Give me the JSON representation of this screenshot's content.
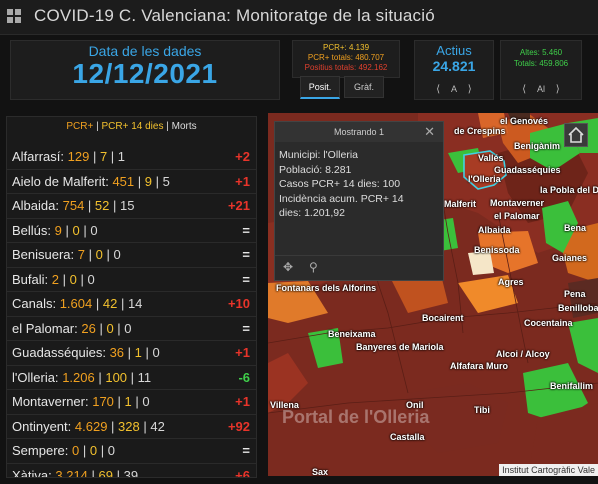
{
  "header": {
    "title": "COVID-19 C. Valenciana: Monitoratge de la situació",
    "icon": "grid-app-icon"
  },
  "date_panel": {
    "label": "Data de les dades",
    "value": "12/12/2021"
  },
  "pcr_panel": {
    "line1": "PCR+: 4.139",
    "line2": "PCR+ totals: 480.707",
    "line3": "Positius totals: 492.162"
  },
  "tabs": [
    {
      "label": "Posit."
    },
    {
      "label": "Gràf."
    }
  ],
  "actius_panel": {
    "label": "Actius",
    "value": "24.821",
    "pager_label": "A"
  },
  "altes_panel": {
    "line1": "Altes: 5.460",
    "line2": "Totals: 459.806",
    "pager_label": "Al"
  },
  "list": {
    "legend": {
      "pcr": "PCR+",
      "pcr14": "PCR+ 14 dies",
      "morts": "Morts"
    },
    "rows": [
      {
        "name": "Alfarrasí:",
        "pcr": "129",
        "pcr14": "7",
        "morts": "1",
        "delta": "+2",
        "delta_type": "pos"
      },
      {
        "name": "Aielo de Malferit:",
        "pcr": "451",
        "pcr14": "9",
        "morts": "5",
        "delta": "+1",
        "delta_type": "pos"
      },
      {
        "name": "Albaida:",
        "pcr": "754",
        "pcr14": "52",
        "morts": "15",
        "delta": "+21",
        "delta_type": "pos"
      },
      {
        "name": "Bellús:",
        "pcr": "9",
        "pcr14": "0",
        "morts": "0",
        "delta": "=",
        "delta_type": "eq"
      },
      {
        "name": "Benisuera:",
        "pcr": "7",
        "pcr14": "0",
        "morts": "0",
        "delta": "=",
        "delta_type": "eq"
      },
      {
        "name": "Bufali:",
        "pcr": "2",
        "pcr14": "0",
        "morts": "0",
        "delta": "=",
        "delta_type": "eq"
      },
      {
        "name": "Canals:",
        "pcr": "1.604",
        "pcr14": "42",
        "morts": "14",
        "delta": "+10",
        "delta_type": "pos"
      },
      {
        "name": "el Palomar:",
        "pcr": "26",
        "pcr14": "0",
        "morts": "0",
        "delta": "=",
        "delta_type": "eq"
      },
      {
        "name": "Guadasséquies:",
        "pcr": "36",
        "pcr14": "1",
        "morts": "0",
        "delta": "+1",
        "delta_type": "pos"
      },
      {
        "name": "l'Olleria:",
        "pcr": "1.206",
        "pcr14": "100",
        "morts": "11",
        "delta": "-6",
        "delta_type": "neg"
      },
      {
        "name": "Montaverner:",
        "pcr": "170",
        "pcr14": "1",
        "morts": "0",
        "delta": "+1",
        "delta_type": "pos"
      },
      {
        "name": "Ontinyent:",
        "pcr": "4.629",
        "pcr14": "328",
        "morts": "42",
        "delta": "+92",
        "delta_type": "pos"
      },
      {
        "name": "Sempere:",
        "pcr": "0",
        "pcr14": "0",
        "morts": "0",
        "delta": "=",
        "delta_type": "eq"
      },
      {
        "name": "Xàtiva:",
        "pcr": "3.214",
        "pcr14": "69",
        "morts": "39",
        "delta": "+6",
        "delta_type": "pos"
      }
    ]
  },
  "map": {
    "attribution": "Institut Cartogràfic Vale",
    "watermark": "Portal de l'Olleria",
    "labels": [
      {
        "text": "el Genovés"
      },
      {
        "text": "de Crespins"
      },
      {
        "text": "Benigànim"
      },
      {
        "text": "Vallés"
      },
      {
        "text": "Guadasséquies"
      },
      {
        "text": "l'Olleria"
      },
      {
        "text": "la Pobla del D"
      },
      {
        "text": "Malferit"
      },
      {
        "text": "Montaverner"
      },
      {
        "text": "el Palomar"
      },
      {
        "text": "Albaida"
      },
      {
        "text": "Benissoda"
      },
      {
        "text": "Gaianes"
      },
      {
        "text": "Agres"
      },
      {
        "text": "Fontanars dels Alforins"
      },
      {
        "text": "Bocairent"
      },
      {
        "text": "Cocentaina"
      },
      {
        "text": "Beneixama"
      },
      {
        "text": "Banyeres de Mariola"
      },
      {
        "text": "Alcoi / Alcoy"
      },
      {
        "text": "Muro"
      },
      {
        "text": "Benifallim"
      },
      {
        "text": "Villena"
      },
      {
        "text": "Onil"
      },
      {
        "text": "Tibi"
      },
      {
        "text": "Castalla"
      },
      {
        "text": "Sax"
      },
      {
        "text": "Bena"
      },
      {
        "text": "Benilloba"
      },
      {
        "text": "Pena"
      },
      {
        "text": "Alfafara"
      }
    ]
  },
  "popup": {
    "header": "Mostrando 1",
    "municipi": "Municipi: l'Olleria",
    "poblacio": "Població: 8.281",
    "casos": "Casos PCR+ 14 dies: 100",
    "incidencia1": "Incidència acum. PCR+ 14",
    "incidencia2": "dies: 1.201,92"
  }
}
